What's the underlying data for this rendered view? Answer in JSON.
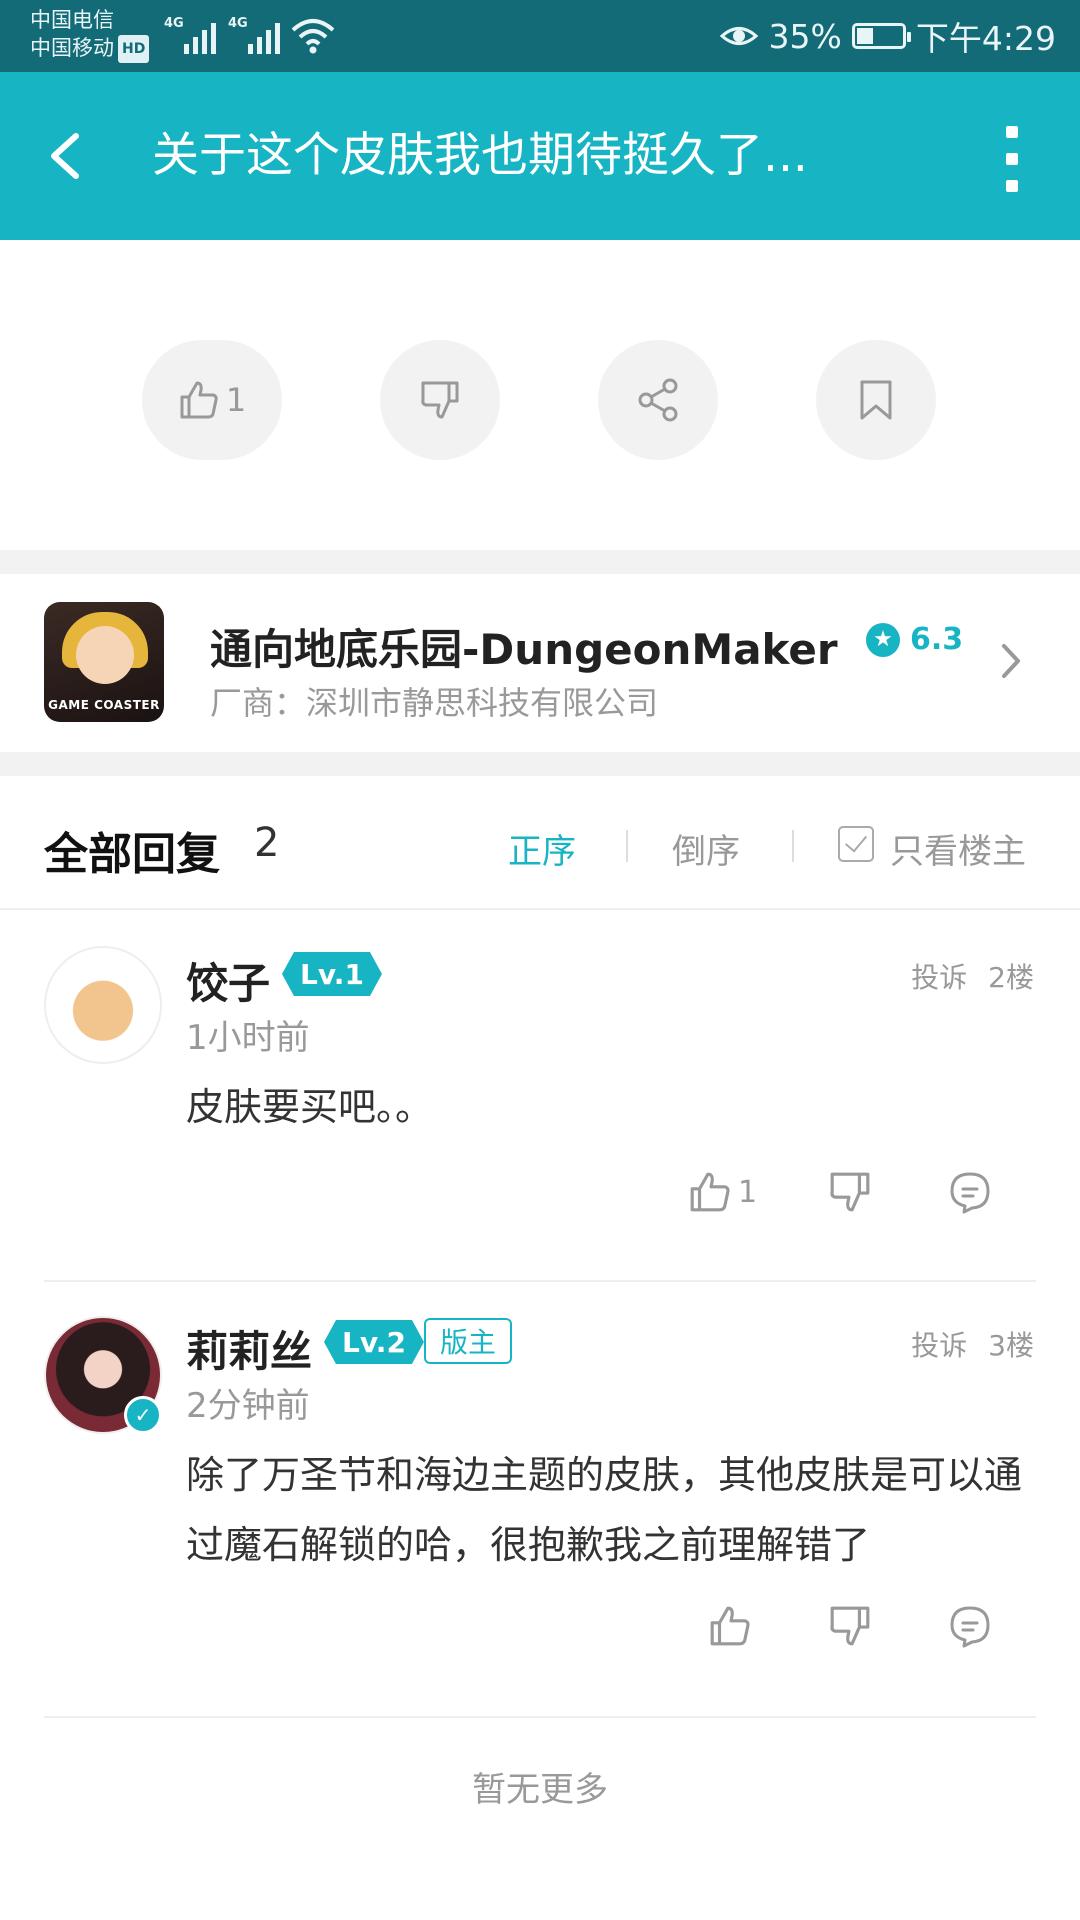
{
  "status_bar": {
    "carrier_1": "中国电信",
    "carrier_2": "中国移动",
    "hd_badge": "HD",
    "network_1": "4G",
    "network_2": "4G",
    "battery": "35%",
    "time": "下午4:29"
  },
  "app_bar": {
    "title": "关于这个皮肤我也期待挺久了..."
  },
  "post_actions": {
    "like_count": "1"
  },
  "game": {
    "name": "通向地底乐园-DungeonMaker",
    "rating": "6.3",
    "vendor": "厂商：深圳市静思科技有限公司",
    "icon_label": "GAME COASTER"
  },
  "replies": {
    "title": "全部回复",
    "count": "2",
    "sort_asc": "正序",
    "sort_desc": "倒序",
    "only_op": "只看楼主"
  },
  "comments": [
    {
      "username": "饺子",
      "level": "Lv.1",
      "report": "投诉",
      "floor": "2楼",
      "time": "1小时前",
      "text": "皮肤要买吧。。",
      "like_count": "1"
    },
    {
      "username": "莉莉丝",
      "level": "Lv.2",
      "badge": "版主",
      "report": "投诉",
      "floor": "3楼",
      "time": "2分钟前",
      "text": "除了万圣节和海边主题的皮肤，其他皮肤是可以通过魔石解锁的哈，很抱歉我之前理解错了",
      "like_count": ""
    }
  ],
  "footer": {
    "no_more": "暂无更多"
  },
  "colors": {
    "accent": "#17b4c4",
    "status_bar": "#136b78"
  }
}
